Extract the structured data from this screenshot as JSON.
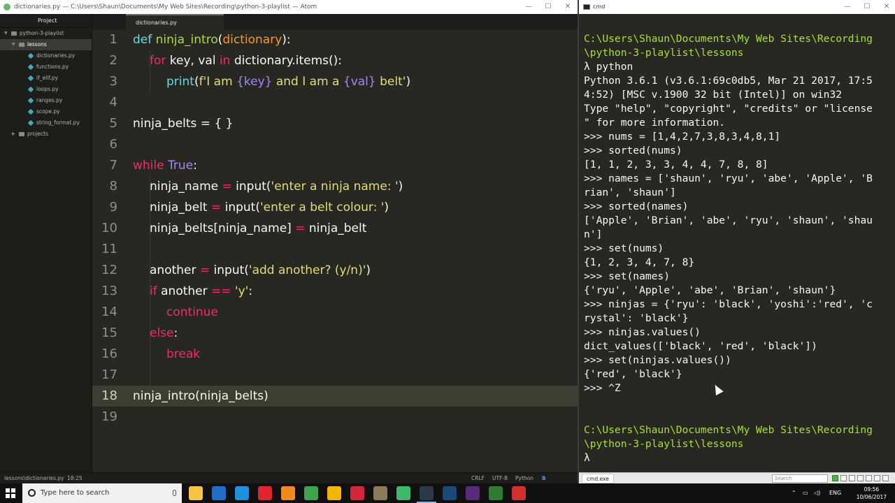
{
  "atom": {
    "title": "dictionaries.py — C:\\Users\\Shaun\\Documents\\My Web Sites\\Recording\\python-3-playlist — Atom",
    "sidebar": {
      "header": "Project",
      "root": "python-3-playlist",
      "folder": "lessons",
      "files": [
        "dictionaries.py",
        "functions.py",
        "if_elif.py",
        "loops.py",
        "ranges.py",
        "scope.py",
        "string_format.py"
      ],
      "other_folder": "projects"
    },
    "tab": "dictionaries.py",
    "line_numbers": [
      "1",
      "2",
      "3",
      "4",
      "5",
      "6",
      "7",
      "8",
      "9",
      "10",
      "11",
      "12",
      "13",
      "14",
      "15",
      "16",
      "17",
      "18",
      "19"
    ],
    "active_line": 18,
    "status": {
      "path": "lessons\\dictionaries.py",
      "cursor": "18:25",
      "line_ending": "CRLF",
      "encoding": "UTF-8",
      "grammar": "Python",
      "updates": "3 updates"
    }
  },
  "code": {
    "l1": {
      "def": "def ",
      "name": "ninja_intro",
      "open": "(",
      "param": "dictionary",
      "close": "):"
    },
    "l2": {
      "for": "for ",
      "mid1": "key, val ",
      "in": "in ",
      "mid2": "dictionary.items():"
    },
    "l3": {
      "fn": "print",
      "open": "(",
      "pre": "f'I am ",
      "v1": "{key}",
      "mid": " and I am a ",
      "v2": "{val}",
      "post": " belt'",
      "close": ")"
    },
    "l5": {
      "text": "ninja_belts = { }"
    },
    "l7": {
      "kw": "while ",
      "val": "True",
      "colon": ":"
    },
    "l8": {
      "a": "ninja_name ",
      "eq": "=",
      "b": " input(",
      "s": "'enter a ninja name: '",
      "c": ")"
    },
    "l9": {
      "a": "ninja_belt ",
      "eq": "=",
      "b": " input(",
      "s": "'enter a belt colour: '",
      "c": ")"
    },
    "l10": {
      "a": "ninja_belts[ninja_name] ",
      "eq": "=",
      "b": " ninja_belt"
    },
    "l12": {
      "a": "another ",
      "eq": "=",
      "b": " input(",
      "s": "'add another? (y/n)'",
      "c": ")"
    },
    "l13": {
      "kw": "if ",
      "a": "another ",
      "eq": "==",
      "sp": " ",
      "s": "'y'",
      "c": ":"
    },
    "l14": {
      "kw": "continue"
    },
    "l15": {
      "kw": "else",
      "c": ":"
    },
    "l16": {
      "kw": "break"
    },
    "l18": {
      "text": "ninja_intro(ninja_belts)"
    }
  },
  "cmd": {
    "title": "cmd",
    "lines": [
      "C:\\Users\\Shaun\\Documents\\My Web Sites\\Recording",
      "\\python-3-playlist\\lessons",
      "λ python",
      "Python 3.6.1 (v3.6.1:69c0db5, Mar 21 2017, 17:5",
      "4:52) [MSC v.1900 32 bit (Intel)] on win32",
      "Type \"help\", \"copyright\", \"credits\" or \"license",
      "\" for more information.",
      ">>> nums = [1,4,2,7,3,8,3,4,8,1]",
      ">>> sorted(nums)",
      "[1, 1, 2, 3, 3, 4, 4, 7, 8, 8]",
      ">>> names = ['shaun', 'ryu', 'abe', 'Apple', 'B",
      "rian', 'shaun']",
      ">>> sorted(names)",
      "['Apple', 'Brian', 'abe', 'ryu', 'shaun', 'shau",
      "n']",
      ">>> set(nums)",
      "{1, 2, 3, 4, 7, 8}",
      ">>> set(names)",
      "{'ryu', 'Apple', 'abe', 'Brian', 'shaun'}",
      ">>> ninjas = {'ryu': 'black', 'yoshi':'red', 'c",
      "rystal': 'black'}",
      ">>> ninjas.values()",
      "dict_values(['black', 'red', 'black'])",
      ">>> set(ninjas.values())",
      "{'red', 'black'}",
      ">>> ^Z",
      "",
      "",
      "C:\\Users\\Shaun\\Documents\\My Web Sites\\Recording",
      "\\python-3-playlist\\lessons",
      "λ"
    ],
    "path_line_indices": [
      0,
      1,
      28,
      29
    ],
    "footer_tab": "cmd.exe",
    "search_placeholder": "Search"
  },
  "taskbar": {
    "search_placeholder": "Type here to search",
    "language": "ENG",
    "time": "09:56",
    "date": "10/06/2017",
    "apps": [
      {
        "name": "file-explorer",
        "color": "#f6c343"
      },
      {
        "name": "outlook",
        "color": "#1e6fc9"
      },
      {
        "name": "edge",
        "color": "#1f8fe0"
      },
      {
        "name": "opera",
        "color": "#e0262c"
      },
      {
        "name": "firefox",
        "color": "#f08a1e"
      },
      {
        "name": "chrome",
        "color": "#3fa34d"
      },
      {
        "name": "norton",
        "color": "#f4b400"
      },
      {
        "name": "vivaldi",
        "color": "#d4263a"
      },
      {
        "name": "archive",
        "color": "#8a7a5a"
      },
      {
        "name": "atom",
        "color": "#3fb86b"
      },
      {
        "name": "console",
        "color": "#2a3a4a"
      },
      {
        "name": "photoshop",
        "color": "#1b4a7a"
      },
      {
        "name": "premiere",
        "color": "#5a2a7a"
      },
      {
        "name": "dreamweaver",
        "color": "#2e7d32"
      },
      {
        "name": "recorder",
        "color": "#d32f2f"
      }
    ]
  }
}
